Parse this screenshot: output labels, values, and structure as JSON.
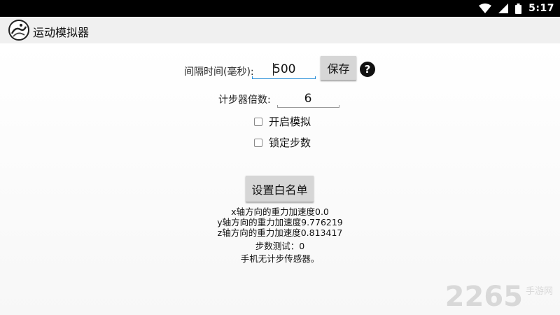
{
  "status_bar": {
    "time": "5:17",
    "icons": [
      "wifi-icon",
      "signal-icon",
      "battery-icon"
    ]
  },
  "action_bar": {
    "title": "运动模拟器",
    "logo": "app-logo-icon"
  },
  "interval": {
    "label": "间隔时间(毫秒):",
    "value": "500",
    "save_label": "保存",
    "help_label": "?"
  },
  "multiplier": {
    "label": "计步器倍数:",
    "value": "6"
  },
  "options": {
    "enable_sim": "开启模拟",
    "lock_steps": "锁定步数"
  },
  "whitelist_button": "设置白名单",
  "info": {
    "x_gravity": "x轴方向的重力加速度0.0",
    "y_gravity": "y轴方向的重力加速度9.776219",
    "z_gravity": "z轴方向的重力加速度0.813417",
    "step_test": "步数测试：0",
    "sensor_status": "手机无计步传感器。"
  },
  "watermark": {
    "number": "2265",
    "text": "手游网"
  },
  "colors": {
    "accent": "#2a8fd8",
    "underline_inactive": "#9a9a9a",
    "button_bg": "#d6d6d6"
  }
}
